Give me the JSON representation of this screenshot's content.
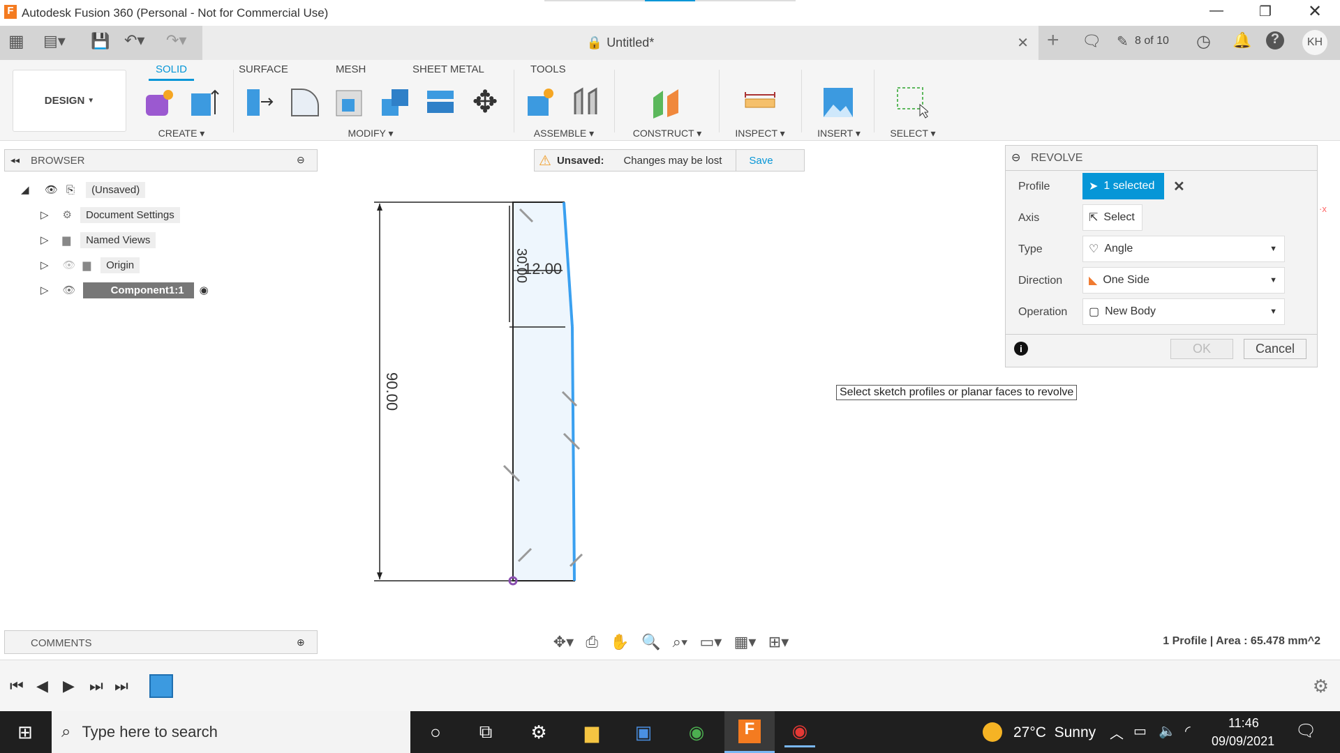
{
  "app": {
    "title": "Autodesk Fusion 360 (Personal - Not for Commercial Use)",
    "doc_title": "Untitled*",
    "job_status": "8 of 10",
    "user_initials": "KH"
  },
  "workspace": {
    "label": "DESIGN"
  },
  "ribbon": {
    "tabs": [
      "SOLID",
      "SURFACE",
      "MESH",
      "SHEET METAL",
      "TOOLS"
    ],
    "active_tab": "SOLID",
    "groups": [
      "CREATE",
      "MODIFY",
      "ASSEMBLE",
      "CONSTRUCT",
      "INSPECT",
      "INSERT",
      "SELECT"
    ]
  },
  "browser": {
    "title": "BROWSER",
    "items": [
      {
        "label": "(Unsaved)"
      },
      {
        "label": "Document Settings"
      },
      {
        "label": "Named Views"
      },
      {
        "label": "Origin"
      },
      {
        "label": "Component1:1"
      }
    ]
  },
  "unsaved": {
    "label": "Unsaved:",
    "message": "Changes may be lost",
    "save": "Save"
  },
  "sketch": {
    "dimensions": [
      "90.00",
      "30.00",
      "12.00"
    ]
  },
  "revolve": {
    "title": "REVOLVE",
    "profile_label": "Profile",
    "profile_value": "1 selected",
    "axis_label": "Axis",
    "axis_value": "Select",
    "type_label": "Type",
    "type_value": "Angle",
    "direction_label": "Direction",
    "direction_value": "One Side",
    "operation_label": "Operation",
    "operation_value": "New Body",
    "ok": "OK",
    "cancel": "Cancel",
    "accent": "#0696d7"
  },
  "tooltip": "Select sketch profiles or planar faces to revolve",
  "comments": {
    "title": "COMMENTS"
  },
  "status": "1 Profile | Area : 65.478 mm^2",
  "taskbar": {
    "search_placeholder": "Type here to search",
    "weather": "27°C  Sunny",
    "time": "11:46",
    "date": "09/09/2021"
  }
}
